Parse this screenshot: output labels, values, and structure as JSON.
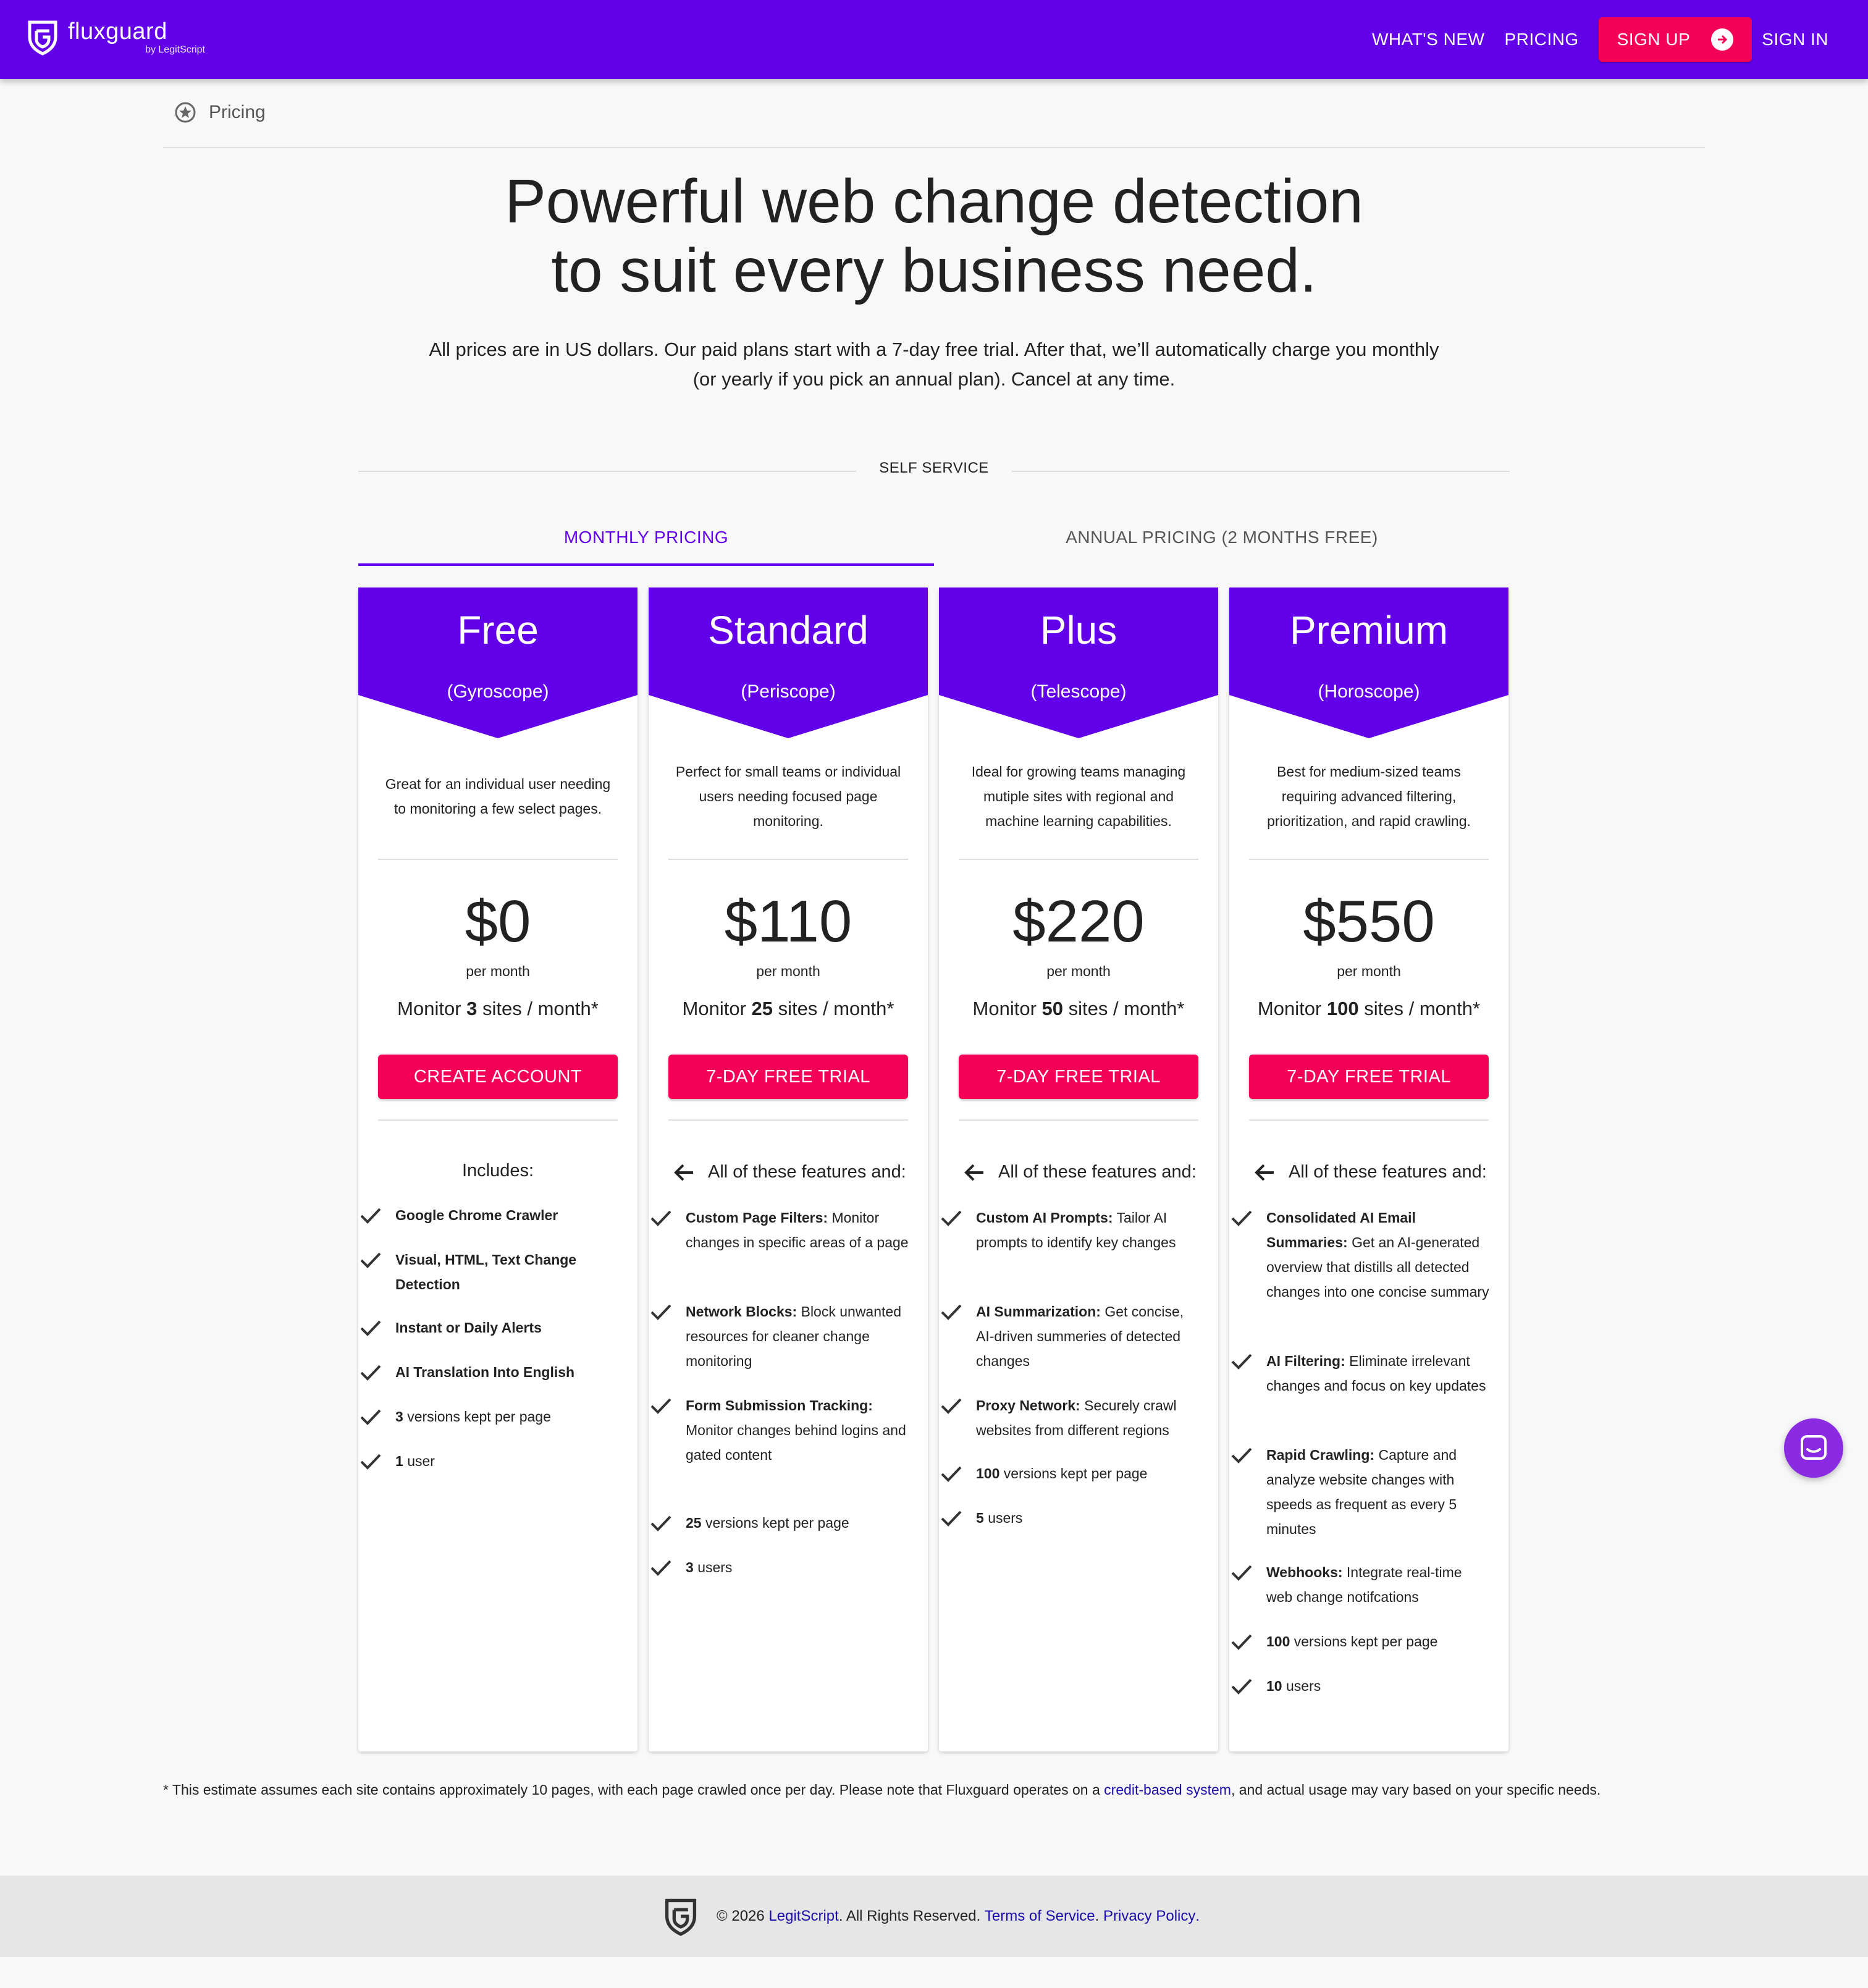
{
  "header": {
    "brand_name": "fluxguard",
    "brand_sub": "by LegitScript",
    "nav": {
      "whats_new": "WHAT'S NEW",
      "pricing": "PRICING",
      "sign_up": "SIGN UP",
      "sign_in": "SIGN IN"
    }
  },
  "breadcrumb": {
    "label": "Pricing"
  },
  "hero": {
    "title_line1": "Powerful web change detection",
    "title_line2": "to suit every business need.",
    "subtitle_line1": "All prices are in US dollars. Our paid plans start with a 7-day free trial. After that, we’ll automatically charge you monthly",
    "subtitle_line2": "(or yearly if you pick an annual plan). Cancel at any time."
  },
  "section": {
    "label": "SELF SERVICE"
  },
  "tabs": {
    "monthly": "MONTHLY PRICING",
    "annual": "ANNUAL PRICING (2 MONTHS FREE)",
    "selected": "MONTHLY PRICING"
  },
  "plans": [
    {
      "name": "Free",
      "code": "(Gyroscope)",
      "description": "Great for an individual user needing to monitoring a few select pages.",
      "price": "$0",
      "period": "per month",
      "monitor_prefix": "Monitor",
      "sites": "3",
      "monitor_suffix": "sites / month*",
      "cta": "CREATE ACCOUNT",
      "includes_heading": "Includes:",
      "features": [
        {
          "bold": "Google Chrome Crawler",
          "text": ""
        },
        {
          "bold": "Visual, HTML, Text Change Detection",
          "text": ""
        },
        {
          "bold": "Instant or Daily Alerts",
          "text": ""
        },
        {
          "bold": "AI Translation Into English",
          "text": ""
        },
        {
          "bold": "3",
          "text": "versions kept per page"
        },
        {
          "bold": "1",
          "text": "user"
        }
      ]
    },
    {
      "name": "Standard",
      "code": "(Periscope)",
      "description": "Perfect for small teams or individual users needing focused page monitoring.",
      "price": "$110",
      "period": "per month",
      "monitor_prefix": "Monitor",
      "sites": "25",
      "monitor_suffix": "sites / month*",
      "cta": "7-DAY FREE TRIAL",
      "includes_heading": "All of these features and:",
      "features": [
        {
          "bold": "Custom Page Filters:",
          "text": "Monitor changes in specific areas of a page"
        },
        {
          "bold": "Network Blocks:",
          "text": "Block unwanted resources for cleaner change monitoring"
        },
        {
          "bold": "Form Submission Tracking:",
          "text": "Monitor changes behind logins and gated content"
        },
        {
          "bold": "25",
          "text": "versions kept per page"
        },
        {
          "bold": "3",
          "text": "users"
        }
      ]
    },
    {
      "name": "Plus",
      "code": "(Telescope)",
      "description": "Ideal for growing teams managing mutiple sites with regional and machine learning capabilities.",
      "price": "$220",
      "period": "per month",
      "monitor_prefix": "Monitor",
      "sites": "50",
      "monitor_suffix": "sites / month*",
      "cta": "7-DAY FREE TRIAL",
      "includes_heading": "All of these features and:",
      "features": [
        {
          "bold": "Custom AI Prompts:",
          "text": "Tailor AI prompts to identify key changes"
        },
        {
          "bold": "AI Summarization:",
          "text": "Get concise, AI-driven summeries of detected changes"
        },
        {
          "bold": "Proxy Network:",
          "text": "Securely crawl websites from different regions"
        },
        {
          "bold": "100",
          "text": "versions kept per page"
        },
        {
          "bold": "5",
          "text": "users"
        }
      ]
    },
    {
      "name": "Premium",
      "code": "(Horoscope)",
      "description": "Best for medium-sized teams requiring advanced filtering, prioritization, and rapid crawling.",
      "price": "$550",
      "period": "per month",
      "monitor_prefix": "Monitor",
      "sites": "100",
      "monitor_suffix": "sites / month*",
      "cta": "7-DAY FREE TRIAL",
      "includes_heading": "All of these features and:",
      "features": [
        {
          "bold": "Consolidated AI Email Summaries:",
          "text": "Get an AI-generated overview that distills all detected changes into one concise summary"
        },
        {
          "bold": "AI Filtering:",
          "text": "Eliminate irrelevant changes and focus on key updates"
        },
        {
          "bold": "Rapid Crawling:",
          "text": "Capture and analyze website changes with speeds as frequent as every 5 minutes"
        },
        {
          "bold": "Webhooks:",
          "text": "Integrate real-time web change notifcations"
        },
        {
          "bold": "100",
          "text": "versions kept per page"
        },
        {
          "bold": "10",
          "text": "users"
        }
      ]
    }
  ],
  "footnote": {
    "before": "* This estimate assumes each site contains approximately 10 pages, with each page crawled once per day. Please note that Fluxguard operates on a",
    "link": "credit-based system",
    "after": ", and actual usage may vary based on your specific needs."
  },
  "footer": {
    "copyright": "© 2026",
    "company_link": "LegitScript",
    "rights": ". All Rights Reserved.",
    "terms_link": "Terms of Service",
    "sep": ".",
    "privacy_link": "Privacy Policy",
    "end": "."
  },
  "colors": {
    "brand_purple": "#6200ea",
    "cta_pink": "#f50057",
    "link_blue": "#1a0dab",
    "chat_purple": "#8a2be2"
  },
  "icons": [
    "fluxguard-logo-icon",
    "arrow-right-circle-icon",
    "settings-badge-icon",
    "back-arrow-icon",
    "check-icon",
    "chat-icon"
  ]
}
